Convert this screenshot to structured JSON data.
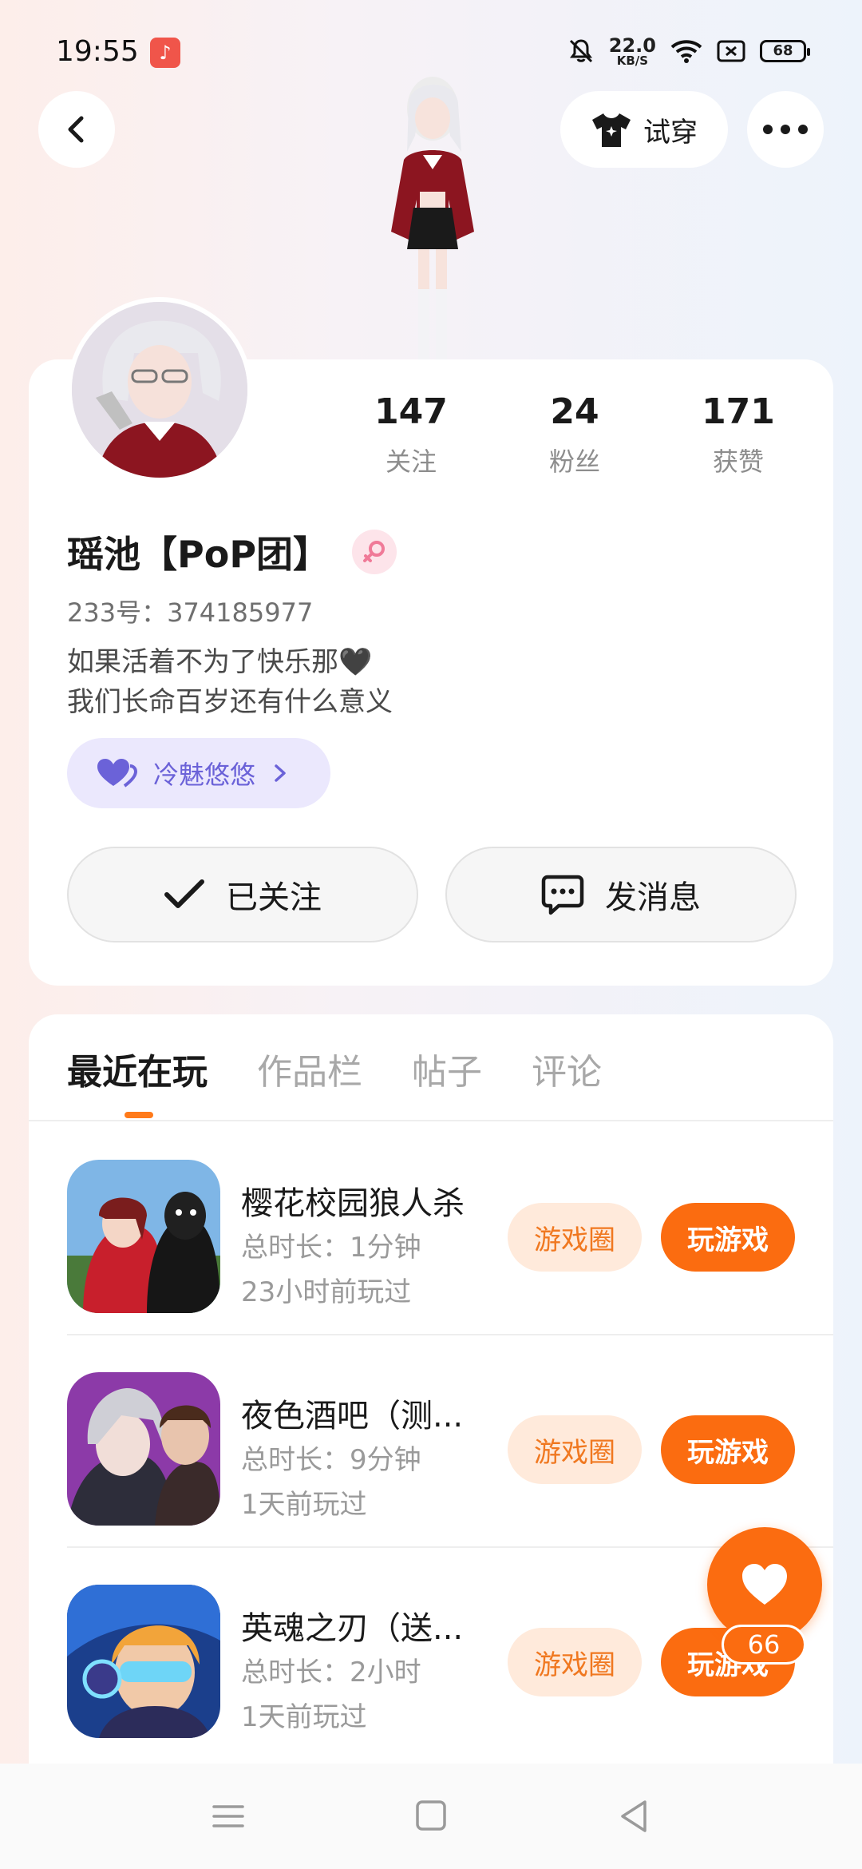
{
  "status_bar": {
    "time": "19:55",
    "net_speed_value": "22.0",
    "net_speed_unit": "KB/S",
    "battery": "68",
    "icons": [
      "music-app-icon",
      "mute-bell-icon",
      "wifi-icon",
      "screen-record-icon",
      "battery-icon"
    ]
  },
  "header": {
    "tryon_label": "试穿"
  },
  "profile": {
    "nickname": "瑶池【PoP团】",
    "uid": "233号：374185977",
    "bio_line1": "如果活着不为了快乐那🖤",
    "bio_line2": "我们长命百岁还有什么意义",
    "fan_tag": "冷魅悠悠",
    "stats": [
      {
        "value": "147",
        "label": "关注"
      },
      {
        "value": "24",
        "label": "粉丝"
      },
      {
        "value": "171",
        "label": "获赞"
      }
    ],
    "follow_label": "已关注",
    "message_label": "发消息"
  },
  "tabs": [
    {
      "label": "最近在玩",
      "active": true
    },
    {
      "label": "作品栏",
      "active": false
    },
    {
      "label": "帖子",
      "active": false
    },
    {
      "label": "评论",
      "active": false
    }
  ],
  "games": [
    {
      "title": "樱花校园狼人杀",
      "duration": "总时长：1分钟",
      "last_played": "23小时前玩过",
      "circle_label": "游戏圈",
      "play_label": "玩游戏"
    },
    {
      "title": "夜色酒吧（测...",
      "duration": "总时长：9分钟",
      "last_played": "1天前玩过",
      "circle_label": "游戏圈",
      "play_label": "玩游戏"
    },
    {
      "title": "英魂之刃（送...",
      "duration": "总时长：2小时",
      "last_played": "1天前玩过",
      "circle_label": "游戏圈",
      "play_label": "玩游戏"
    }
  ],
  "like": {
    "count": "66"
  },
  "colors": {
    "accent": "#fb6c10",
    "accent_light": "#ffeadb",
    "fan_tag_bg": "#ebe8fd",
    "fan_tag_text": "#6b62d8"
  }
}
